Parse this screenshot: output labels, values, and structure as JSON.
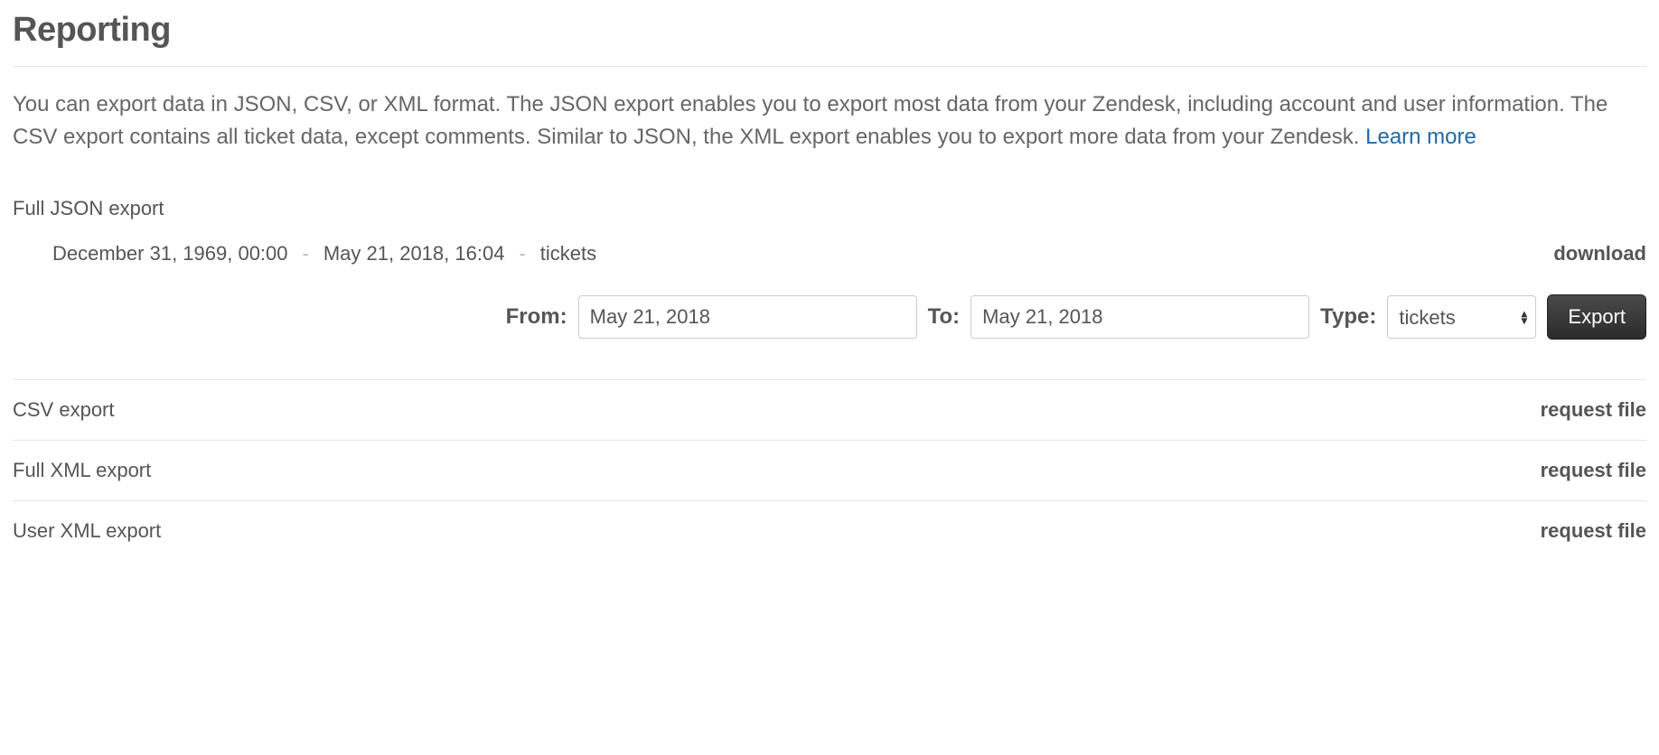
{
  "page": {
    "title": "Reporting",
    "intro_text": "You can export data in JSON, CSV, or XML format. The JSON export enables you to export most data from your Zendesk, including account and user information. The CSV export contains all ticket data, except comments. Similar to JSON, the XML export enables you to export more data from your Zendesk. ",
    "learn_more": "Learn more"
  },
  "json_export": {
    "label": "Full JSON export",
    "range_start": "December 31, 1969, 00:00",
    "range_end": "May 21, 2018, 16:04",
    "range_type": "tickets",
    "download_label": "download",
    "separator": "-"
  },
  "form": {
    "from_label": "From:",
    "from_value": "May 21, 2018",
    "to_label": "To:",
    "to_value": "May 21, 2018",
    "type_label": "Type:",
    "type_value": "tickets",
    "export_button": "Export"
  },
  "rows": {
    "csv": {
      "label": "CSV export",
      "action": "request file"
    },
    "full_xml": {
      "label": "Full XML export",
      "action": "request file"
    },
    "user_xml": {
      "label": "User XML export",
      "action": "request file"
    }
  }
}
